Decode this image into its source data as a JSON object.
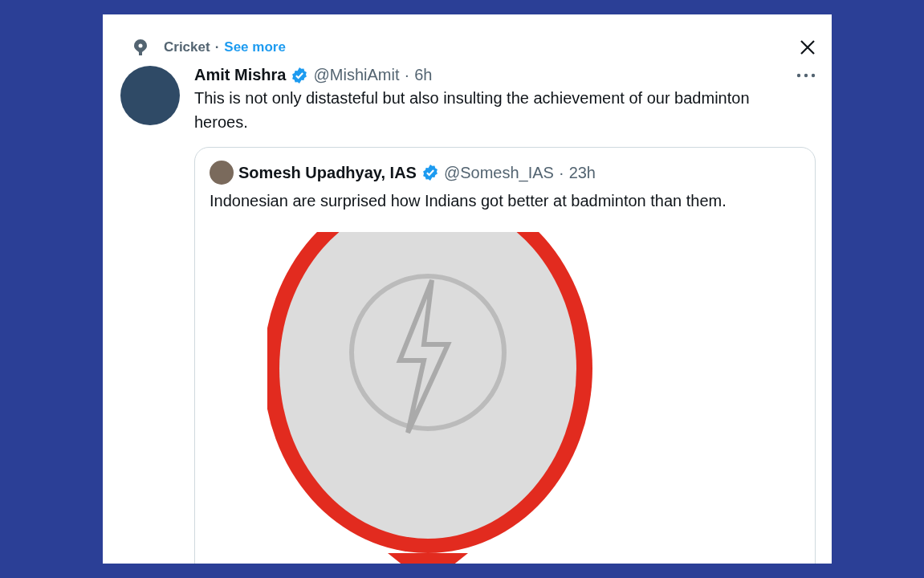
{
  "topic": {
    "label": "Cricket",
    "separator": "·",
    "link": "See more"
  },
  "tweet": {
    "author": "Amit Mishra",
    "verified": true,
    "handle": "@MishiAmit",
    "separator": "·",
    "time": "6h",
    "text": "This is not only distasteful but also insulting the achievement of our badminton heroes."
  },
  "quoted": {
    "author": "Somesh Upadhyay, IAS",
    "verified": true,
    "handle": "@Somesh_IAS",
    "separator": "·",
    "time": "23h",
    "text": "Indonesian are surprised how Indians got better at badminton than them."
  }
}
